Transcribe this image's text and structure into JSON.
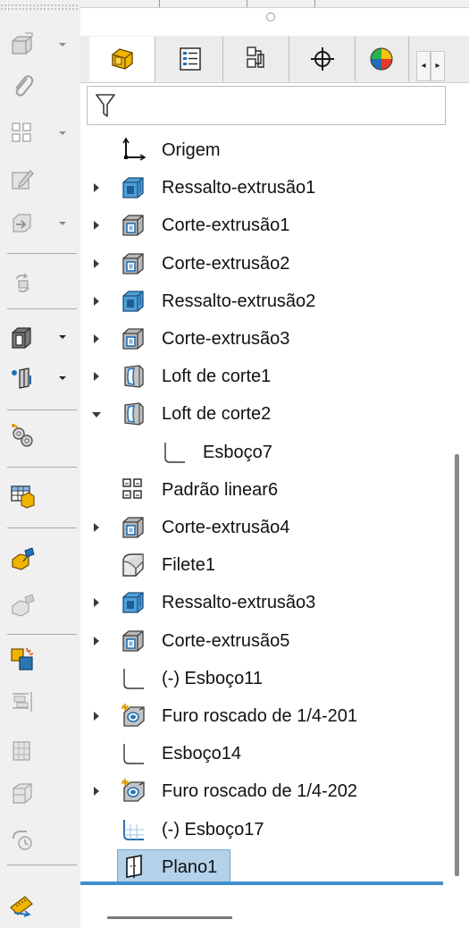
{
  "left_toolbar": {
    "buttons": [
      {
        "icon": "extruded-boss-icon",
        "enabled": false,
        "has_dropdown": true
      },
      {
        "icon": "paperclip-icon",
        "enabled": false,
        "has_dropdown": false
      },
      {
        "icon": "pattern-icon",
        "enabled": false,
        "has_dropdown": true
      },
      {
        "icon": "sketch-edit-icon",
        "enabled": false,
        "has_dropdown": false
      },
      {
        "icon": "insert-part-icon",
        "enabled": false,
        "has_dropdown": true
      },
      {
        "icon": "rebuild-icon",
        "enabled": false,
        "has_dropdown": false
      },
      {
        "icon": "extruded-cut-icon",
        "enabled": true,
        "has_dropdown": true
      },
      {
        "icon": "reference-plane-icon",
        "enabled": true,
        "has_dropdown": true
      },
      {
        "icon": "gears-settings-icon",
        "enabled": true,
        "has_dropdown": false
      },
      {
        "icon": "design-table-icon",
        "enabled": true,
        "has_dropdown": false
      },
      {
        "icon": "mate-icon",
        "enabled": true,
        "has_dropdown": false
      },
      {
        "icon": "mate-disabled-icon",
        "enabled": false,
        "has_dropdown": false
      },
      {
        "icon": "configuration-icon",
        "enabled": true,
        "has_dropdown": false
      },
      {
        "icon": "align-icon",
        "enabled": false,
        "has_dropdown": false
      },
      {
        "icon": "component-icon",
        "enabled": false,
        "has_dropdown": false
      },
      {
        "icon": "part-icon",
        "enabled": false,
        "has_dropdown": false
      },
      {
        "icon": "timer-icon",
        "enabled": false,
        "has_dropdown": false
      },
      {
        "icon": "measure-icon",
        "enabled": true,
        "has_dropdown": false
      }
    ]
  },
  "tabs": [
    {
      "name": "feature-manager",
      "icon": "feature-manager-icon",
      "active": true
    },
    {
      "name": "property-manager",
      "icon": "property-manager-icon",
      "active": false
    },
    {
      "name": "configuration-manager",
      "icon": "configuration-manager-icon",
      "active": false
    },
    {
      "name": "dimxpert-manager",
      "icon": "crosshair-icon",
      "active": false
    },
    {
      "name": "display-manager",
      "icon": "display-manager-icon",
      "active": false
    }
  ],
  "tab_scroll": {
    "left": "◂",
    "right": "▸"
  },
  "filter": {
    "icon": "filter-icon"
  },
  "tree": [
    {
      "label": "Origem",
      "icon": "origin-icon",
      "expander": "none",
      "indent": 0
    },
    {
      "label": "Ressalto-extrusão1",
      "icon": "boss-extrude-icon",
      "expander": "collapsed",
      "indent": 0
    },
    {
      "label": "Corte-extrusão1",
      "icon": "cut-extrude-icon",
      "expander": "collapsed",
      "indent": 0
    },
    {
      "label": "Corte-extrusão2",
      "icon": "cut-extrude-icon",
      "expander": "collapsed",
      "indent": 0
    },
    {
      "label": "Ressalto-extrusão2",
      "icon": "boss-extrude-icon",
      "expander": "collapsed",
      "indent": 0
    },
    {
      "label": "Corte-extrusão3",
      "icon": "cut-extrude-icon",
      "expander": "collapsed",
      "indent": 0
    },
    {
      "label": "Loft de corte1",
      "icon": "cut-loft-icon",
      "expander": "collapsed",
      "indent": 0
    },
    {
      "label": "Loft de corte2",
      "icon": "cut-loft-icon",
      "expander": "expanded",
      "indent": 0
    },
    {
      "label": "Esboço7",
      "icon": "sketch-icon",
      "expander": "none",
      "indent": 1
    },
    {
      "label": "Padrão linear6",
      "icon": "linear-pattern-icon",
      "expander": "none",
      "indent": 0
    },
    {
      "label": "Corte-extrusão4",
      "icon": "cut-extrude-icon",
      "expander": "collapsed",
      "indent": 0
    },
    {
      "label": "Filete1",
      "icon": "fillet-icon",
      "expander": "none",
      "indent": 0
    },
    {
      "label": "Ressalto-extrusão3",
      "icon": "boss-extrude-icon",
      "expander": "collapsed",
      "indent": 0
    },
    {
      "label": "Corte-extrusão5",
      "icon": "cut-extrude-icon",
      "expander": "collapsed",
      "indent": 0
    },
    {
      "label": "(-) Esboço11",
      "icon": "sketch-icon",
      "expander": "none",
      "indent": 0
    },
    {
      "label": "Furo roscado de 1/4-201",
      "icon": "hole-wizard-icon",
      "expander": "collapsed",
      "indent": 0
    },
    {
      "label": "Esboço14",
      "icon": "sketch-icon",
      "expander": "none",
      "indent": 0
    },
    {
      "label": "Furo roscado de 1/4-202",
      "icon": "hole-wizard-icon",
      "expander": "collapsed",
      "indent": 0
    },
    {
      "label": "(-) Esboço17",
      "icon": "sketch-grid-icon",
      "expander": "none",
      "indent": 0
    },
    {
      "label": "Plano1",
      "icon": "plane-icon",
      "expander": "none",
      "indent": 0,
      "selected": true
    }
  ],
  "colors": {
    "selection_fill": "#b3d2ea",
    "selection_border": "#76a9d6",
    "rollback_bar": "#3f8fcc",
    "feature_blue": "#2f7fc1",
    "feature_gray": "#8a8a8a"
  }
}
